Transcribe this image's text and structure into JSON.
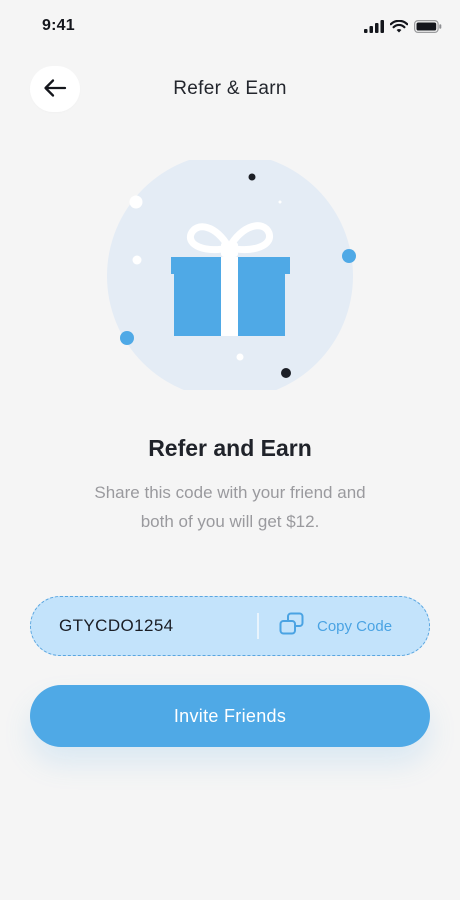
{
  "status": {
    "time": "9:41",
    "icons": [
      "signal-icon",
      "wifi-icon",
      "battery-icon"
    ]
  },
  "header": {
    "back_icon": "arrow-left-icon",
    "title": "Refer & Earn"
  },
  "illustration": {
    "icon": "gift-icon",
    "colors": {
      "circle": "#e4ecf5",
      "gift": "#4fa9e6",
      "ribbon": "#ffffff",
      "dot_dark": "#1c1f26",
      "dot_blue": "#4fa9e6"
    }
  },
  "content": {
    "heading": "Refer and Earn",
    "description": "Share this code with your friend and both of you will get $12."
  },
  "referral": {
    "code": "GTYCDO1254",
    "copy_label": "Copy Code",
    "copy_icon": "copy-icon"
  },
  "actions": {
    "invite_label": "Invite Friends"
  },
  "colors": {
    "accent": "#4fa9e6",
    "code_bg": "#c3e3fb",
    "background": "#f5f5f5"
  }
}
